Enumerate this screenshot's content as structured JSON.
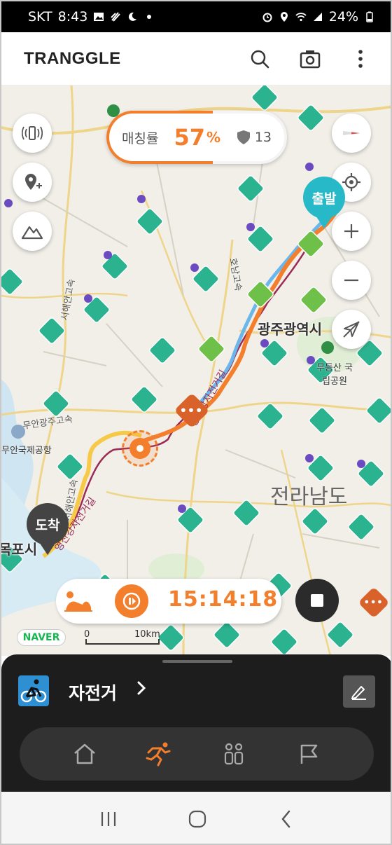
{
  "status_bar": {
    "carrier": "SKT",
    "time": "8:43",
    "battery": "24%",
    "left_icons": [
      "gallery-icon",
      "app-notification-icon",
      "sleep-mode-icon",
      "dot-icon"
    ],
    "right_icons": [
      "alarm-icon",
      "location-icon",
      "wifi-icon",
      "signal-icon",
      "battery-icon"
    ]
  },
  "app_bar": {
    "logo": "TRANGGLE",
    "actions": [
      "search-icon",
      "camera-icon",
      "more-vertical-icon"
    ]
  },
  "map": {
    "labels": {
      "city_gwangju": "광주광역시",
      "city_mokpo": "목포시",
      "province": "전라남도",
      "airport": "무안국제공항",
      "park": "무등산 국립공원",
      "road_honam": "호남고속",
      "road_muan": "무안광주고속",
      "road_seohae": "서해안고속",
      "road_seohae2": "서해안고속",
      "bike_path": "영산강자전거길",
      "bike_path2": "영산강자전거길"
    },
    "match_rate": {
      "label": "매칭률",
      "value": "57",
      "unit": "%",
      "shield_count": "13"
    },
    "start_marker": "출발",
    "end_marker": "도착",
    "left_controls": [
      "nearby-device-icon",
      "add-location-icon",
      "mountain-icon"
    ],
    "right_controls": [
      "compass-icon",
      "my-location-icon",
      "zoom-in-icon",
      "zoom-out-icon",
      "location-off-icon"
    ],
    "naver_badge": "NAVER",
    "scale": {
      "start": "0",
      "end": "10km"
    },
    "colors": {
      "route_orange": "#f37f2c",
      "route_yellow": "#f7c948",
      "route_blue": "#6bb6ea",
      "bike_path": "#9a2a55",
      "mountain_teal": "#2bb28f",
      "park_green": "#6ec048",
      "start_teal": "#27b9c7"
    }
  },
  "activity": {
    "mode_icon": "resting-person-icon",
    "timer": "15:14:18",
    "pause_icon": "pause-icon",
    "stop_icon": "stop-icon"
  },
  "bottom_panel": {
    "activity_name": "자전거",
    "activity_icon": "bicycle-icon",
    "edit_icon": "edit-icon",
    "tabs": [
      {
        "name": "home",
        "icon": "home-icon",
        "active": false
      },
      {
        "name": "activity",
        "icon": "running-person-icon",
        "active": true
      },
      {
        "name": "community",
        "icon": "people-icon",
        "active": false
      },
      {
        "name": "challenge",
        "icon": "flag-icon",
        "active": false
      }
    ]
  },
  "system_nav": [
    "recent-apps-icon",
    "home-circle-icon",
    "back-icon"
  ]
}
